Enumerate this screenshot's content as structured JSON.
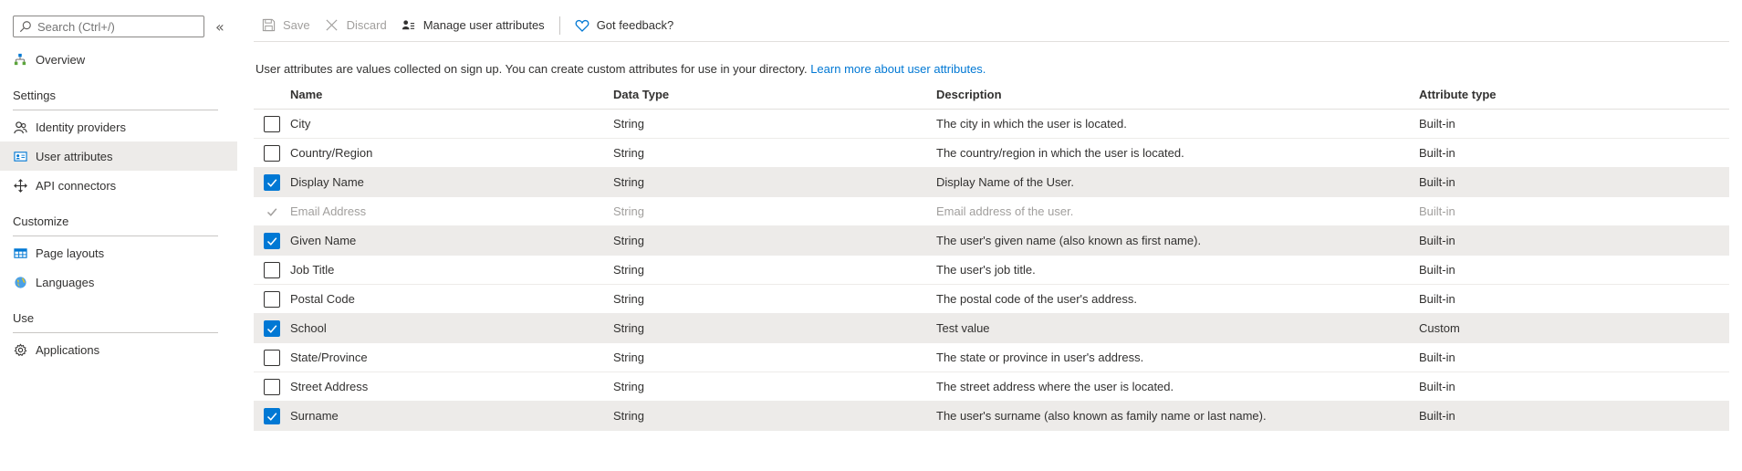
{
  "colors": {
    "accent": "#0078d4",
    "selected_row": "#edebe9",
    "disabled_text": "#a19f9d"
  },
  "sidebar": {
    "search": {
      "placeholder": "Search (Ctrl+/)",
      "value": ""
    },
    "collapse_glyph": "«",
    "overview": {
      "label": "Overview",
      "icon": "tree-icon"
    },
    "sections": [
      {
        "title": "Settings",
        "items": [
          {
            "label": "Identity providers",
            "icon": "people-icon",
            "selected": false
          },
          {
            "label": "User attributes",
            "icon": "contact-card-icon",
            "selected": true
          },
          {
            "label": "API connectors",
            "icon": "move-arrows-icon",
            "selected": false
          }
        ]
      },
      {
        "title": "Customize",
        "items": [
          {
            "label": "Page layouts",
            "icon": "table-icon",
            "selected": false
          },
          {
            "label": "Languages",
            "icon": "globe-icon",
            "selected": false
          }
        ]
      },
      {
        "title": "Use",
        "items": [
          {
            "label": "Applications",
            "icon": "gear-icon",
            "selected": false
          }
        ]
      }
    ]
  },
  "toolbar": {
    "save_label": "Save",
    "discard_label": "Discard",
    "manage_label": "Manage user attributes",
    "feedback_label": "Got feedback?"
  },
  "intro": {
    "text": "User attributes are values collected on sign up. You can create custom attributes for use in your directory.",
    "link": "Learn more about user attributes."
  },
  "table": {
    "headers": {
      "name": "Name",
      "type": "Data Type",
      "description": "Description",
      "attr_type": "Attribute type"
    },
    "rows": [
      {
        "name": "City",
        "type": "String",
        "description": "The city in which the user is located.",
        "attr_type": "Built-in",
        "checked": false,
        "disabled": false
      },
      {
        "name": "Country/Region",
        "type": "String",
        "description": "The country/region in which the user is located.",
        "attr_type": "Built-in",
        "checked": false,
        "disabled": false
      },
      {
        "name": "Display Name",
        "type": "String",
        "description": "Display Name of the User.",
        "attr_type": "Built-in",
        "checked": true,
        "disabled": false
      },
      {
        "name": "Email Address",
        "type": "String",
        "description": "Email address of the user.",
        "attr_type": "Built-in",
        "checked": true,
        "disabled": true
      },
      {
        "name": "Given Name",
        "type": "String",
        "description": "The user's given name (also known as first name).",
        "attr_type": "Built-in",
        "checked": true,
        "disabled": false
      },
      {
        "name": "Job Title",
        "type": "String",
        "description": "The user's job title.",
        "attr_type": "Built-in",
        "checked": false,
        "disabled": false
      },
      {
        "name": "Postal Code",
        "type": "String",
        "description": "The postal code of the user's address.",
        "attr_type": "Built-in",
        "checked": false,
        "disabled": false
      },
      {
        "name": "School",
        "type": "String",
        "description": "Test value",
        "attr_type": "Custom",
        "checked": true,
        "disabled": false
      },
      {
        "name": "State/Province",
        "type": "String",
        "description": "The state or province in user's address.",
        "attr_type": "Built-in",
        "checked": false,
        "disabled": false
      },
      {
        "name": "Street Address",
        "type": "String",
        "description": "The street address where the user is located.",
        "attr_type": "Built-in",
        "checked": false,
        "disabled": false
      },
      {
        "name": "Surname",
        "type": "String",
        "description": "The user's surname (also known as family name or last name).",
        "attr_type": "Built-in",
        "checked": true,
        "disabled": false
      }
    ]
  }
}
